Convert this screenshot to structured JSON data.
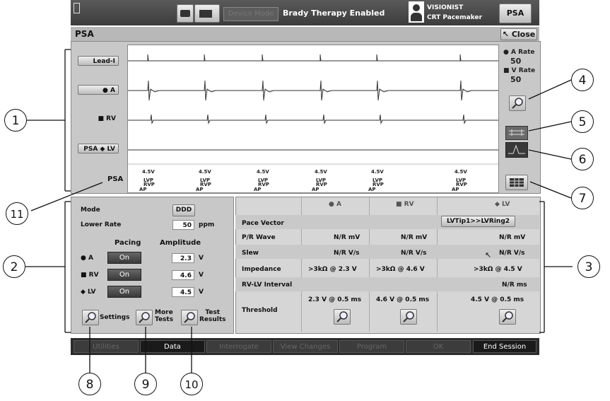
{
  "header": {
    "device_mode": "Device Mode",
    "therapy_status": "Brady Therapy Enabled",
    "device_name": "VISIONIST",
    "device_type": "CRT Pacemaker",
    "psa_tab": "PSA"
  },
  "window": {
    "title": "PSA",
    "close_label": "Close"
  },
  "ecg": {
    "channels": [
      "Lead-I",
      "● A",
      "■ RV",
      "PSA ◆ LV"
    ],
    "psa_label": "PSA",
    "a_rate_label": "● A Rate",
    "a_rate_value": "50",
    "v_rate_label": "■ V Rate",
    "v_rate_value": "50",
    "markers": [
      "4.5V",
      "4.5V",
      "4.5V",
      "4.5V",
      "4.5V",
      "4.5V"
    ],
    "marker_lvp": "LVP",
    "marker_rvp": "RVP",
    "marker_ap": "AP"
  },
  "settings": {
    "mode_label": "Mode",
    "mode_value": "DDD",
    "lower_rate_label": "Lower Rate",
    "lower_rate_value": "50",
    "lower_rate_unit": "ppm",
    "pacing_header": "Pacing",
    "amplitude_header": "Amplitude",
    "rows": [
      {
        "chamber": "● A",
        "pacing": "On",
        "amplitude": "2.3",
        "unit": "V"
      },
      {
        "chamber": "■ RV",
        "pacing": "On",
        "amplitude": "4.6",
        "unit": "V"
      },
      {
        "chamber": "◆ LV",
        "pacing": "On",
        "amplitude": "4.5",
        "unit": "V"
      }
    ],
    "settings_label": "Settings",
    "more_tests_label_1": "More",
    "more_tests_label_2": "Tests",
    "test_results_label_1": "Test",
    "test_results_label_2": "Results"
  },
  "measurements": {
    "headers": [
      "● A",
      "■ RV",
      "◆ LV"
    ],
    "pace_vector_label": "Pace Vector",
    "pace_vector_value": "LVTip1>>LVRing2",
    "pwave_label": "P/R Wave",
    "pwave": [
      "N/R  mV",
      "N/R  mV",
      "N/R  mV"
    ],
    "slew_label": "Slew",
    "slew": [
      "N/R  V/s",
      "N/R  V/s",
      "N/R  V/s"
    ],
    "impedance_label": "Impedance",
    "impedance": [
      ">3kΩ @ 2.3  V",
      ">3kΩ @ 4.6  V",
      ">3kΩ @ 4.5  V"
    ],
    "rvlv_label": "RV-LV Interval",
    "rvlv_value": "N/R  ms",
    "threshold_label": "Threshold",
    "threshold": [
      "2.3 V @ 0.5  ms",
      "4.6 V @ 0.5  ms",
      "4.5 V @ 0.5  ms"
    ]
  },
  "bottom_nav": [
    "Utilities",
    "Data",
    "Interrogate",
    "View Changes",
    "Program",
    "OK",
    "End Session"
  ],
  "callouts": [
    "1",
    "2",
    "3",
    "4",
    "5",
    "6",
    "7",
    "8",
    "9",
    "10",
    "11"
  ],
  "colors": {
    "accent_button": "#3c3c3c",
    "panel": "#c8c8c8"
  }
}
